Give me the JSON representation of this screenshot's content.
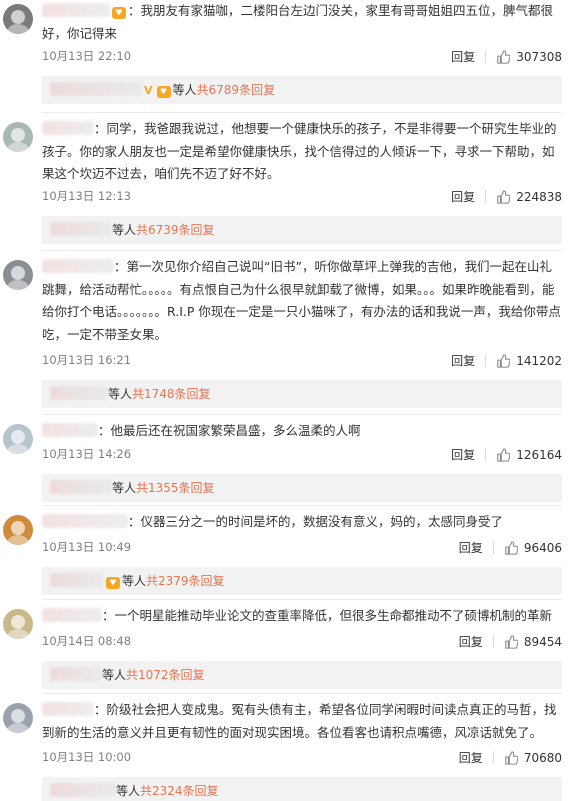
{
  "labels": {
    "reply": "回复",
    "reply_bar_suffix": "等人",
    "v_badge": "V"
  },
  "comments": [
    {
      "avatar_color": "#7a7a7a",
      "text": "：我朋友有家猫咖，二楼阳台左边门没关，家里有哥哥姐姐四五位，脾气都很好，你记得来",
      "time": "10月13日 22:10",
      "likes": "307308",
      "reply_more": "共6789条回复"
    },
    {
      "avatar_color": "#a9b8b0",
      "text": "：同学，我爸跟我说过，他想要一个健康快乐的孩子，不是非得要一个研究生毕业的孩子。你的家人朋友也一定是希望你健康快乐，找个信得过的人倾诉一下，寻求一下帮助，如果这个坎迈不过去，咱们先不迈了好不好。",
      "time": "10月13日 12:13",
      "likes": "224838",
      "reply_more": "共6739条回复"
    },
    {
      "avatar_color": "#8a8f96",
      "text": "：第一次见你介绍自己说叫“旧书”，听你做草坪上弹我的吉他，我们一起在山礼跳舞，给活动帮忙。。。。。有点恨自己为什么很早就卸载了微博，如果。。。如果昨晚能看到，能给你打个电话。。。。。。。R.I.P 你现在一定是一只小猫咪了，有办法的话和我说一声，我给你带点吃，一定不带圣女果。",
      "time": "10月13日 16:21",
      "likes": "141202",
      "reply_more": "共1748条回复"
    },
    {
      "avatar_color": "#b8c4cc",
      "text": "：他最后还在祝国家繁荣昌盛，多么温柔的人啊",
      "time": "10月13日 14:26",
      "likes": "126164",
      "reply_more": "共1355条回复"
    },
    {
      "avatar_color": "#d08a3c",
      "text": "：仪器三分之一的时间是坏的，数据没有意义，妈的，太感同身受了",
      "time": "10月13日 10:49",
      "likes": "96406",
      "reply_more": "共2379条回复"
    },
    {
      "avatar_color": "#c9b98a",
      "text": "：一个明星能推动毕业论文的查重率降低，但很多生命都推动不了硕博机制的革新",
      "time": "10月14日 08:48",
      "likes": "89454",
      "reply_more": "共1072条回复"
    },
    {
      "avatar_color": "#9aa3ad",
      "text": "：阶级社会把人变成鬼。冤有头债有主，希望各位同学闲暇时间读点真正的马哲，找到新的生活的意义并且更有韧性的面对现实困境。各位看客也请积点嘴德，风凉话就免了。",
      "time": "10月13日 10:00",
      "likes": "70680",
      "reply_more": "共2324条回复"
    }
  ]
}
